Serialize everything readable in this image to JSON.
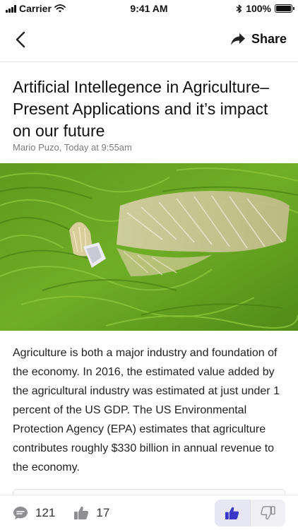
{
  "status_bar": {
    "carrier": "Carrier",
    "time": "9:41 AM",
    "battery": "100%"
  },
  "nav": {
    "share_label": "Share"
  },
  "article": {
    "title": "Artificial Intellegence in Agriculture–Present Applications and it’s impact on our future",
    "byline": "Mario Puzo, Today at 9:55am",
    "body": "Agriculture is both a major industry and foundation of the economy. In 2016, the estimated value added by the agricultural industry was estimated at just under 1 percent of the US GDP. The US Environmental Protection Agency (EPA) estimates that agriculture contributes roughly $330 billion in annual revenue to the economy."
  },
  "engagement": {
    "comments": "121",
    "likes": "17"
  },
  "colors": {
    "accent": "#3a36c8",
    "muted": "#8e8e93"
  }
}
